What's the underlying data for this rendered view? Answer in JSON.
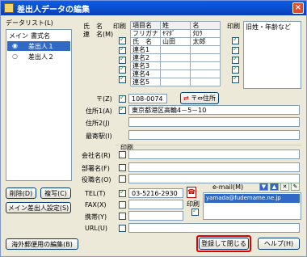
{
  "window": {
    "title": "差出人データの編集",
    "close_glyph": "×"
  },
  "list_panel": {
    "label": "データリスト(L)",
    "columns": [
      "メイン",
      "書式名"
    ],
    "rows": [
      {
        "name": "差出人１",
        "selected": true
      },
      {
        "name": "差出人２",
        "selected": false
      }
    ]
  },
  "left_buttons": {
    "delete": "削除(D)",
    "duplicate": "複写(C)",
    "main_setting": "メイン差出人設定(S)",
    "overseas_edit": "海外郵便用の編集(B)"
  },
  "names": {
    "name_label": "氏　名",
    "couple_label": "連　名(M)",
    "print_label": "印刷",
    "grid_headers": [
      "項目名",
      "姓",
      "名"
    ],
    "grid_rows": [
      [
        "フリガナ",
        "ﾔﾏﾀﾞ",
        "ﾀﾛｳ"
      ],
      [
        "氏　名",
        "山田",
        "太郎"
      ],
      [
        "連名1",
        "",
        ""
      ],
      [
        "連名2",
        "",
        ""
      ],
      [
        "連名3",
        "",
        ""
      ],
      [
        "連名4",
        "",
        ""
      ],
      [
        "連名5",
        "",
        ""
      ]
    ],
    "right_print_label": "印刷",
    "right_header": "旧姓・年齢など"
  },
  "address": {
    "zip_label": "〒(Z)",
    "zip_value": "108-0074",
    "zip_button": "〒⇔住所",
    "addr1_label": "住所1(A)",
    "addr1_value": "東京都港区高輪4－5－10",
    "addr2_label": "住所2(J)",
    "station_label": "最寄駅(I)"
  },
  "company": {
    "print_label": "印刷",
    "company_label": "会社名(R)",
    "dept_label": "部署名(F)",
    "title_label": "役職名(O)"
  },
  "contact": {
    "tel_label": "TEL(T)",
    "tel_value": "03-5216-2930",
    "fax_label": "FAX(X)",
    "mobile_label": "携帯(Y)",
    "url_label": "URL(U)",
    "print_label": "印刷",
    "email_label": "e-mail(M)",
    "email_value": "yamada@fudemame.ne.jp"
  },
  "bottom_buttons": {
    "save_close": "登録して閉じる",
    "help": "ヘルプ(H)"
  }
}
